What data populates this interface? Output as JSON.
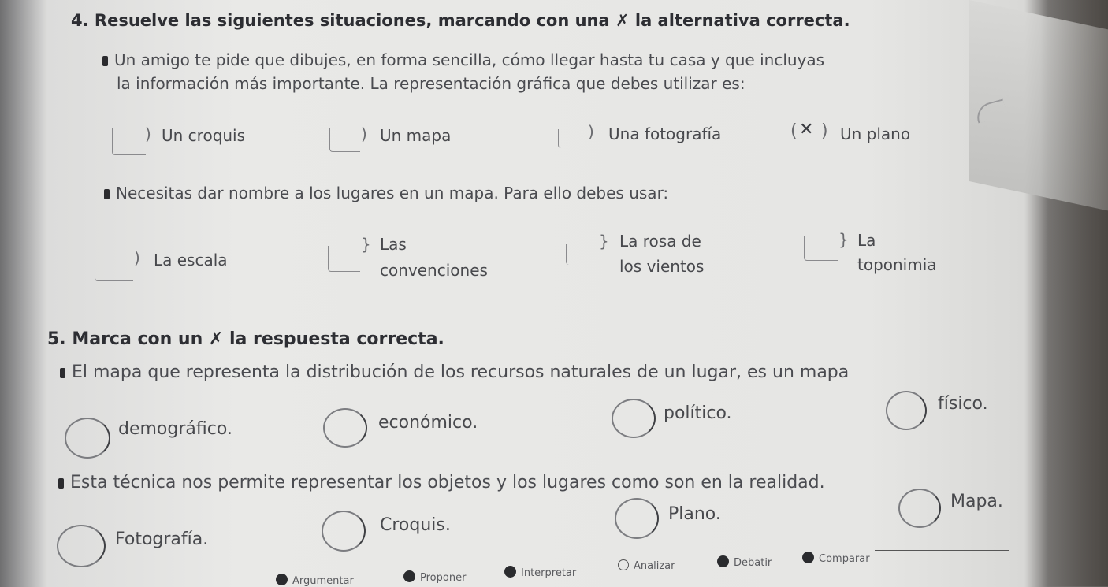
{
  "section4": {
    "heading": "4. Resuelve las siguientes situaciones, marcando con una ✗ la alternativa correcta.",
    "q1": {
      "text_line1": "Un amigo te pide que dibujes, en forma sencilla, cómo llegar hasta tu casa y que incluyas",
      "text_line2": "la información más importante. La representación gráfica que debes utilizar es:",
      "options": [
        "Un croquis",
        "Un mapa",
        "Una fotografía",
        "Un plano"
      ],
      "marked_option": "Un plano",
      "mark_symbol": "✕"
    },
    "q2": {
      "text": "Necesitas dar nombre a los lugares en un mapa. Para ello debes usar:",
      "options": [
        {
          "line1": "La escala",
          "line2": ""
        },
        {
          "line1": "Las",
          "line2": "convenciones"
        },
        {
          "line1": "La rosa de",
          "line2": "los vientos"
        },
        {
          "line1": "La",
          "line2": "toponimia"
        }
      ]
    }
  },
  "section5": {
    "heading": "5. Marca con un ✗ la respuesta correcta.",
    "q1": {
      "text": "El mapa que representa la distribución de los recursos naturales de un lugar, es un mapa",
      "options": [
        "demográfico.",
        "económico.",
        "político.",
        "físico."
      ]
    },
    "q2": {
      "text": "Esta técnica nos permite representar los objetos y los lugares como son en la realidad.",
      "options": [
        "Fotografía.",
        "Croquis.",
        "Plano.",
        "Mapa."
      ]
    }
  },
  "footer": {
    "items": [
      "Argumentar",
      "Proponer",
      "Interpretar",
      "Analizar",
      "Debatir",
      "Comparar"
    ]
  },
  "colors": {
    "ink": "#3e3e40",
    "heading_ink": "#2d2e33",
    "paper": "#e8e8e6"
  }
}
